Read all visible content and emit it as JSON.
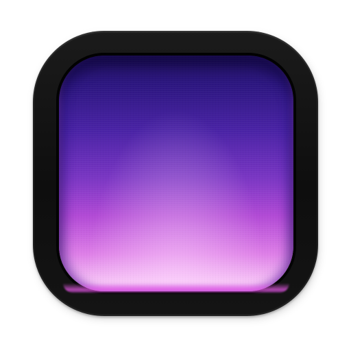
{
  "icon": {
    "name": "purple-gradient-screen-app-icon",
    "colors": {
      "bezel": "#111111",
      "screen_top": "#1e0f5e",
      "screen_mid": "#7a36c4",
      "screen_bottom": "#fbd6f9",
      "glow": "#eb5aeb"
    }
  }
}
